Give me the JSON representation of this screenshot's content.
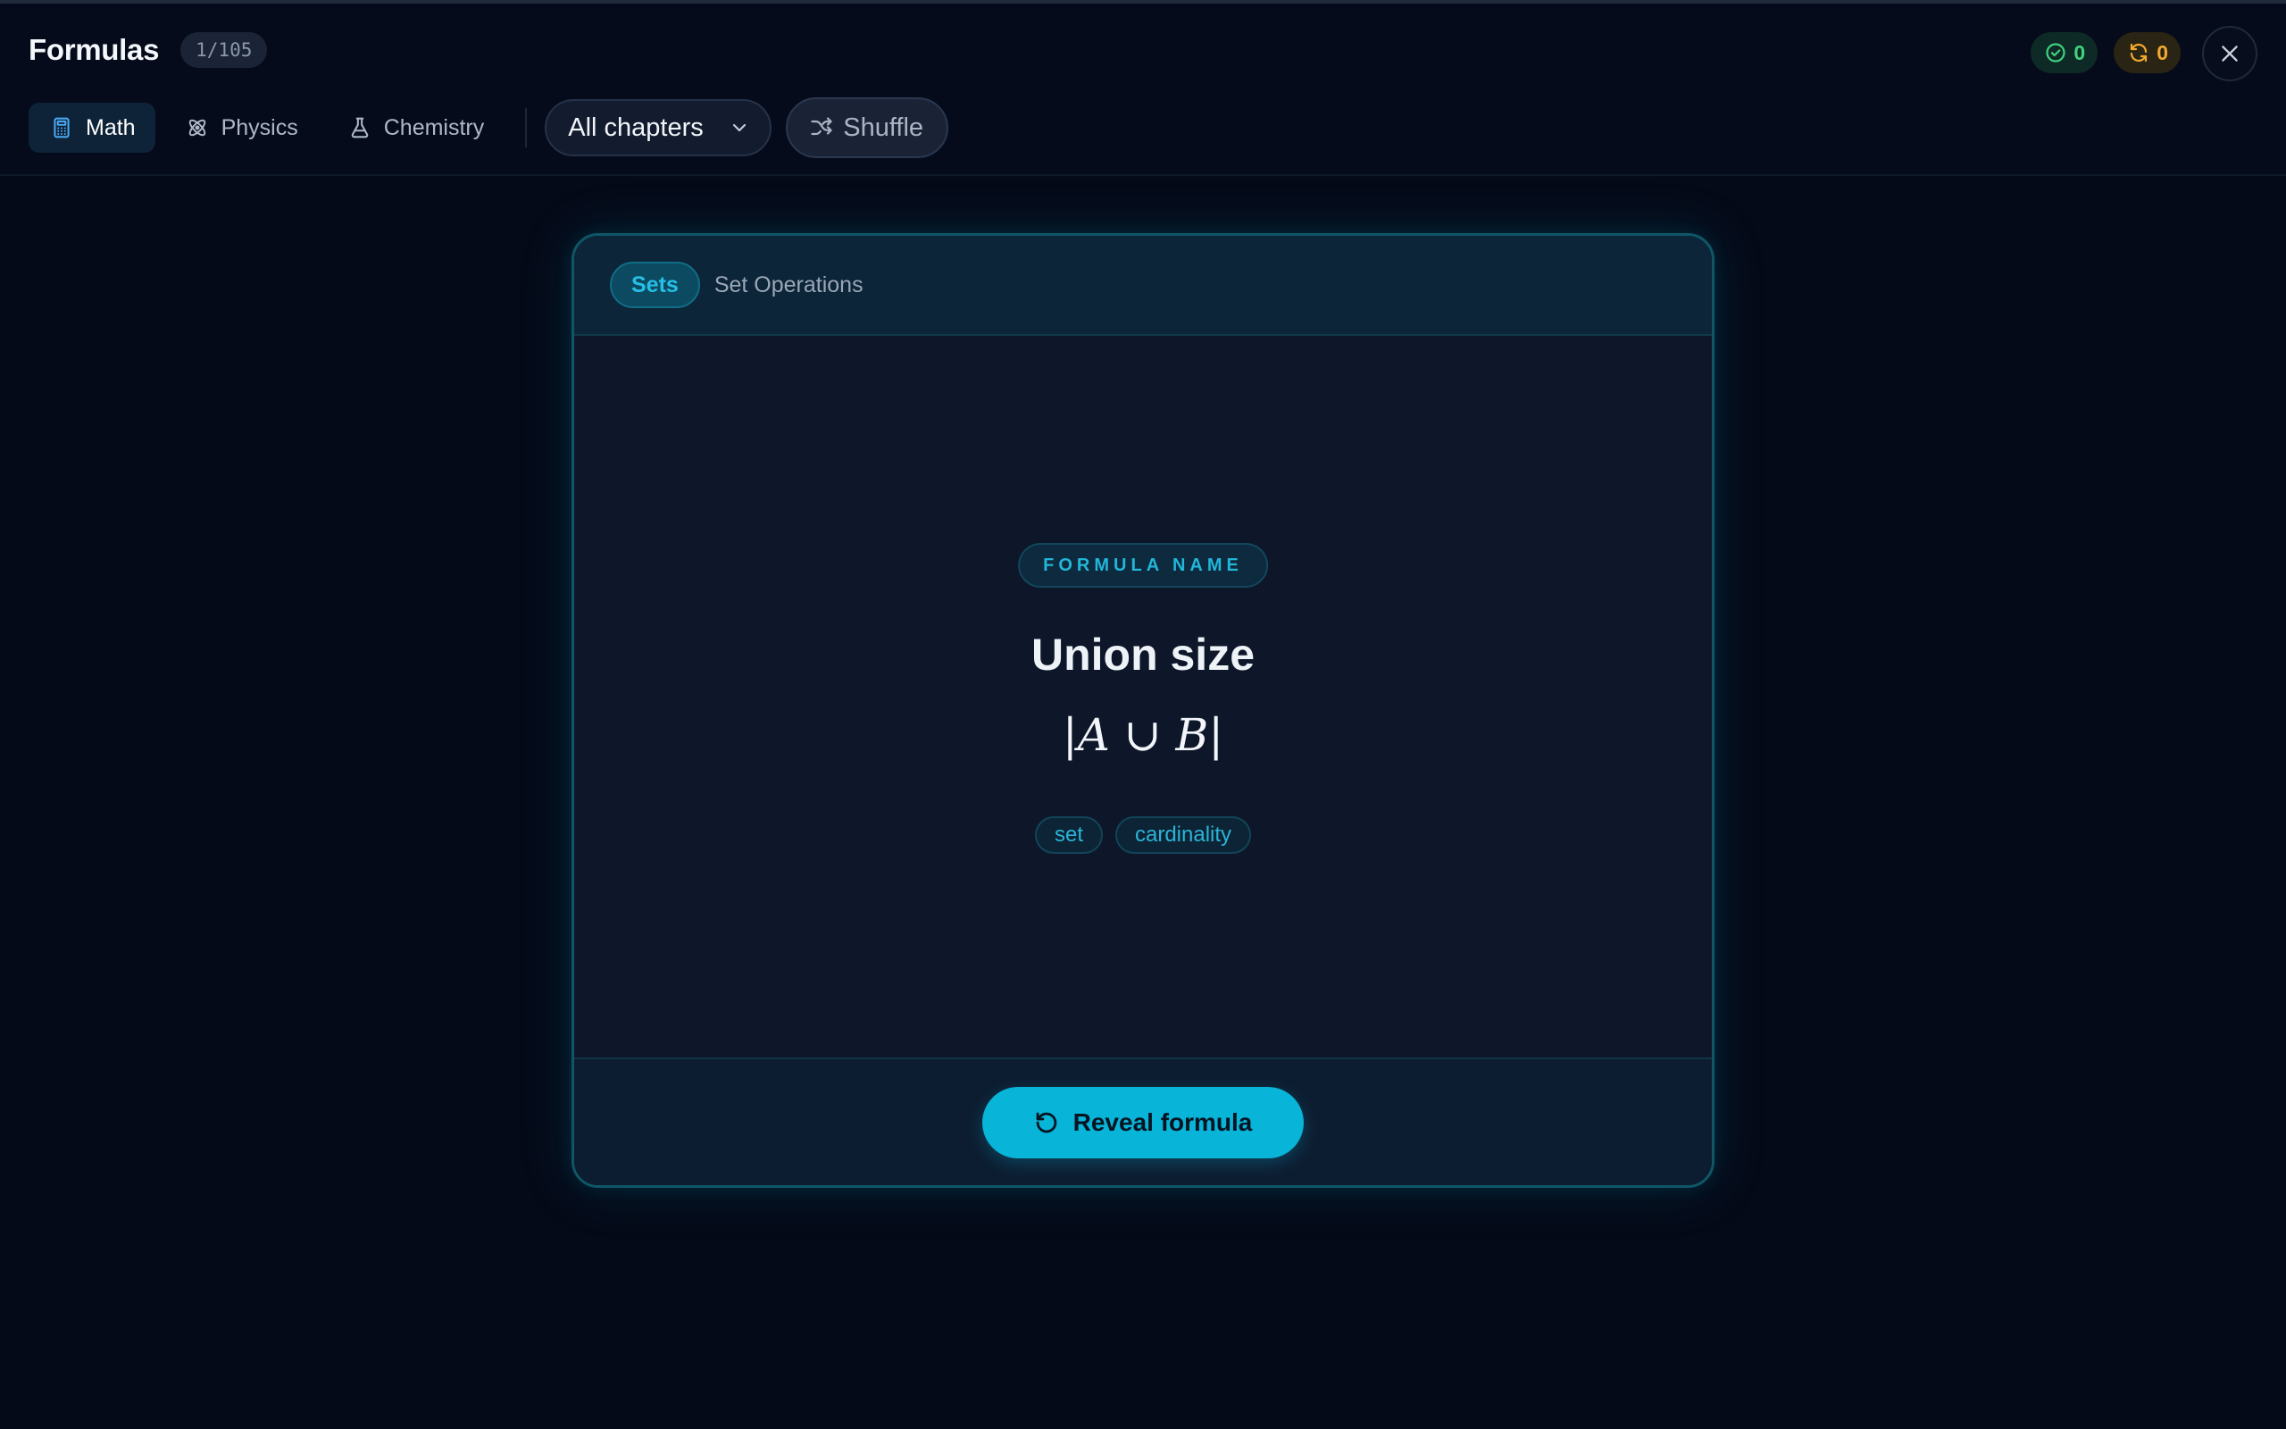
{
  "header": {
    "title": "Formulas",
    "counter": "1/105",
    "known_count": "0",
    "review_count": "0"
  },
  "toolbar": {
    "tabs": [
      {
        "label": "Math",
        "icon": "calculator-icon",
        "active": true
      },
      {
        "label": "Physics",
        "icon": "atom-icon",
        "active": false
      },
      {
        "label": "Chemistry",
        "icon": "flask-icon",
        "active": false
      }
    ],
    "chapter_select": "All chapters",
    "shuffle_label": "Shuffle"
  },
  "card": {
    "topic": "Sets",
    "chapter": "Set Operations",
    "label": "FORMULA NAME",
    "formula_name": "Union size",
    "formula_expr": "|A ∪ B|",
    "tags": [
      "set",
      "cardinality"
    ],
    "reveal_label": "Reveal formula"
  },
  "colors": {
    "accent": "#08b4d8",
    "known": "#3fd37d",
    "review": "#f0a92e",
    "background": "#050a18"
  }
}
